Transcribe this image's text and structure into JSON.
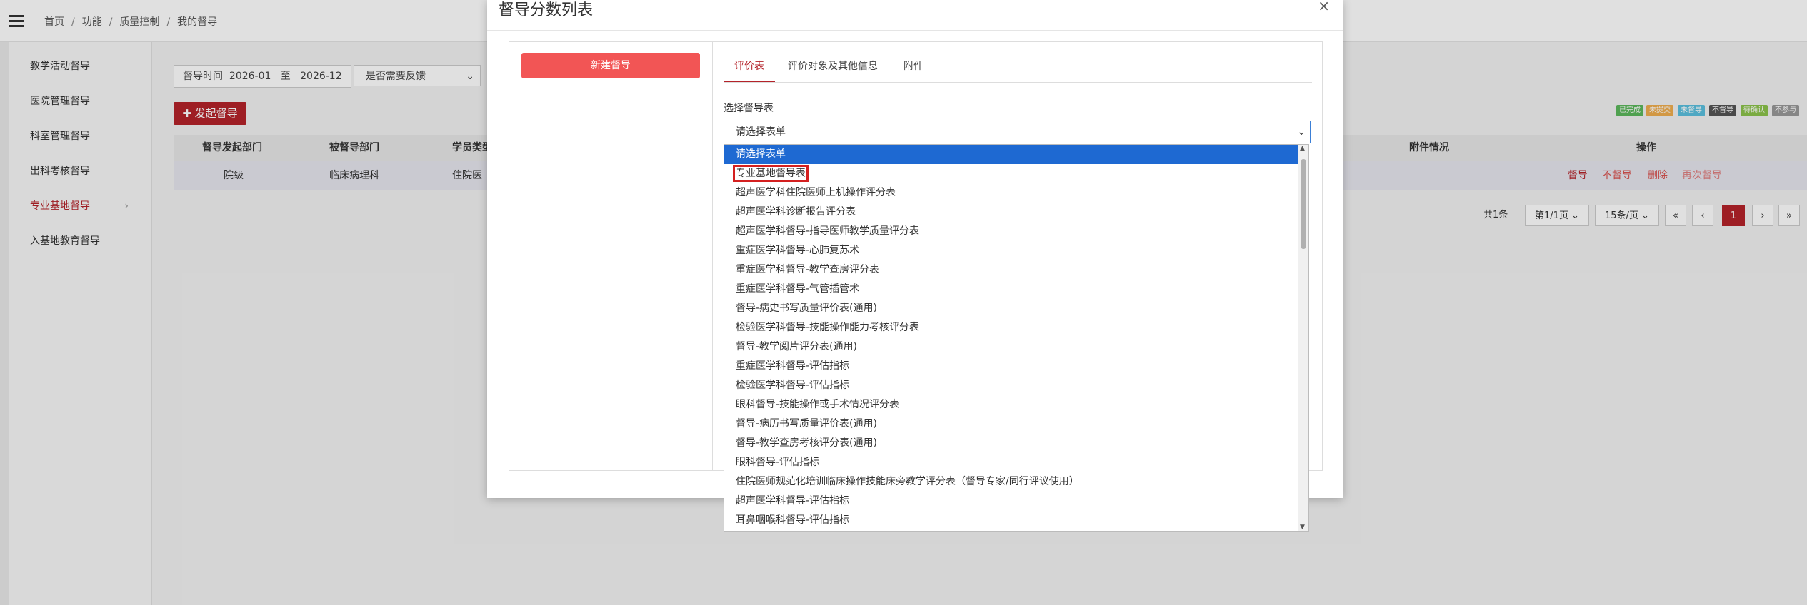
{
  "breadcrumb": [
    "首页",
    "功能",
    "质量控制",
    "我的督导"
  ],
  "sidebar": {
    "items": [
      {
        "label": "教学活动督导"
      },
      {
        "label": "医院管理督导"
      },
      {
        "label": "科室管理督导"
      },
      {
        "label": "出科考核督导"
      },
      {
        "label": "专业基地督导",
        "active": true
      },
      {
        "label": "入基地教育督导"
      }
    ]
  },
  "filters": {
    "time_label": "督导时间",
    "time_from": "2026-01",
    "time_to_label": "至",
    "time_to": "2026-12",
    "feedback_select": "是否需要反馈"
  },
  "launch_button": "发起督导",
  "status_legend": [
    {
      "label": "已完成",
      "color": "#5cb85c"
    },
    {
      "label": "未提交",
      "color": "#f0ad4e"
    },
    {
      "label": "未督导",
      "color": "#5bc0de"
    },
    {
      "label": "不督导",
      "color": "#555555"
    },
    {
      "label": "待确认",
      "color": "#8bc34a"
    },
    {
      "label": "不参与",
      "color": "#999999"
    }
  ],
  "table": {
    "headers": [
      "督导发起部门",
      "被督导部门",
      "学员类型",
      "附件情况",
      "操作"
    ],
    "rows": [
      {
        "dept": "院级",
        "target": "临床病理科",
        "type": "住院医"
      }
    ],
    "actions": [
      "督导",
      "不督导",
      "删除",
      "再次督导"
    ]
  },
  "pagination": {
    "total": "共1条",
    "page_select": "第1/1页",
    "size_select": "15条/页",
    "first": "«",
    "prev": "‹",
    "current": "1",
    "next": "›",
    "last": "»"
  },
  "modal": {
    "title": "督导分数列表",
    "close": "×",
    "new_button": "新建督导",
    "tabs": [
      "评价表",
      "评价对象及其他信息",
      "附件"
    ],
    "form_label": "选择督导表",
    "select_value": "请选择表单",
    "options": [
      "请选择表单",
      "专业基地督导表",
      "超声医学科住院医师上机操作评分表",
      "超声医学科诊断报告评分表",
      "超声医学科督导-指导医师教学质量评分表",
      "重症医学科督导-心肺复苏术",
      "重症医学科督导-教学查房评分表",
      "重症医学科督导-气管插管术",
      "督导-病史书写质量评价表(通用)",
      "检验医学科督导-技能操作能力考核评分表",
      "督导-教学阅片评分表(通用)",
      "重症医学科督导-评估指标",
      "检验医学科督导-评估指标",
      "眼科督导-技能操作或手术情况评分表",
      "督导-病历书写质量评价表(通用)",
      "督导-教学查房考核评分表(通用)",
      "眼科督导-评估指标",
      "住院医师规范化培训临床操作技能床旁教学评分表（督导专家/同行评议使用）",
      "超声医学科督导-评估指标",
      "耳鼻咽喉科督导-评估指标"
    ]
  }
}
